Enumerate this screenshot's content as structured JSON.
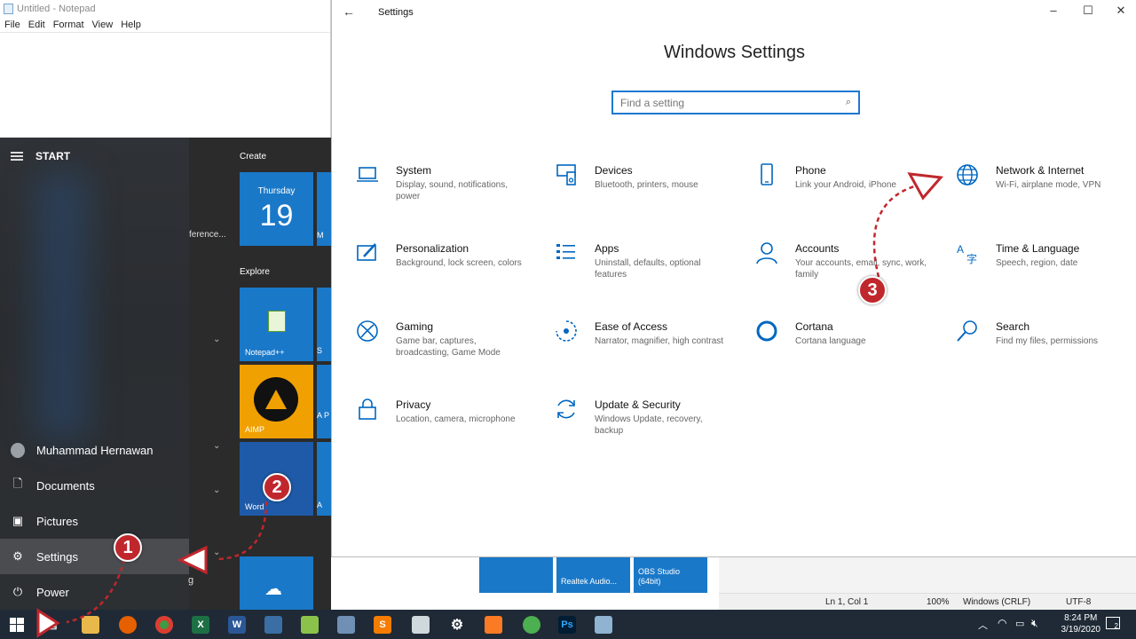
{
  "notepad": {
    "title": "Untitled - Notepad",
    "menu": [
      "File",
      "Edit",
      "Format",
      "View",
      "Help"
    ]
  },
  "start": {
    "header": "START",
    "truncated_text": "ference...",
    "groups": {
      "create": "Create",
      "explore": "Explore"
    },
    "tiles": {
      "calendar_day": "Thursday",
      "calendar_date": "19",
      "notepadpp": "Notepad++",
      "aimp": "AIMP",
      "word": "Word",
      "edge_m": "M",
      "edge_s": "S",
      "edge_a": "A P",
      "edge_at": "A"
    },
    "items": [
      {
        "label": "Muhammad Hernawan",
        "icon": "avatar"
      },
      {
        "label": "Documents",
        "icon": "document-icon"
      },
      {
        "label": "Pictures",
        "icon": "pictures-icon"
      },
      {
        "label": "Settings",
        "icon": "gear-icon"
      },
      {
        "label": "Power",
        "icon": "power-icon"
      }
    ],
    "extra_glyph": "g"
  },
  "settings": {
    "title": "Settings",
    "heading": "Windows Settings",
    "search_placeholder": "Find a setting",
    "categories": [
      {
        "name": "System",
        "desc": "Display, sound, notifications, power",
        "icon": "laptop-icon"
      },
      {
        "name": "Devices",
        "desc": "Bluetooth, printers, mouse",
        "icon": "devices-icon"
      },
      {
        "name": "Phone",
        "desc": "Link your Android, iPhone",
        "icon": "phone-icon"
      },
      {
        "name": "Network & Internet",
        "desc": "Wi-Fi, airplane mode, VPN",
        "icon": "globe-icon"
      },
      {
        "name": "Personalization",
        "desc": "Background, lock screen, colors",
        "icon": "paint-icon"
      },
      {
        "name": "Apps",
        "desc": "Uninstall, defaults, optional features",
        "icon": "apps-icon"
      },
      {
        "name": "Accounts",
        "desc": "Your accounts, email, sync, work, family",
        "icon": "person-icon"
      },
      {
        "name": "Time & Language",
        "desc": "Speech, region, date",
        "icon": "time-language-icon"
      },
      {
        "name": "Gaming",
        "desc": "Game bar, captures, broadcasting, Game Mode",
        "icon": "xbox-icon"
      },
      {
        "name": "Ease of Access",
        "desc": "Narrator, magnifier, high contrast",
        "icon": "ease-of-access-icon"
      },
      {
        "name": "Cortana",
        "desc": "Cortana language",
        "icon": "cortana-icon"
      },
      {
        "name": "Search",
        "desc": "Find my files, permissions",
        "icon": "search-icon"
      },
      {
        "name": "Privacy",
        "desc": "Location, camera, microphone",
        "icon": "lock-icon"
      },
      {
        "name": "Update & Security",
        "desc": "Windows Update, recovery, backup",
        "icon": "refresh-icon"
      }
    ]
  },
  "bottom_tiles": {
    "realtek": "Realtek Audio...",
    "obs": "OBS Studio (64bit)"
  },
  "statusbar": {
    "position": "Ln 1, Col 1",
    "zoom": "100%",
    "line_ending": "Windows (CRLF)",
    "encoding": "UTF-8"
  },
  "taskbar": {
    "time": "8:24 PM",
    "date": "3/19/2020",
    "notifications": "2"
  },
  "annotations": [
    "1",
    "2",
    "3"
  ],
  "colors": {
    "accent": "#0067c0",
    "tile": "#1a78c8",
    "badge": "#c0272d"
  }
}
